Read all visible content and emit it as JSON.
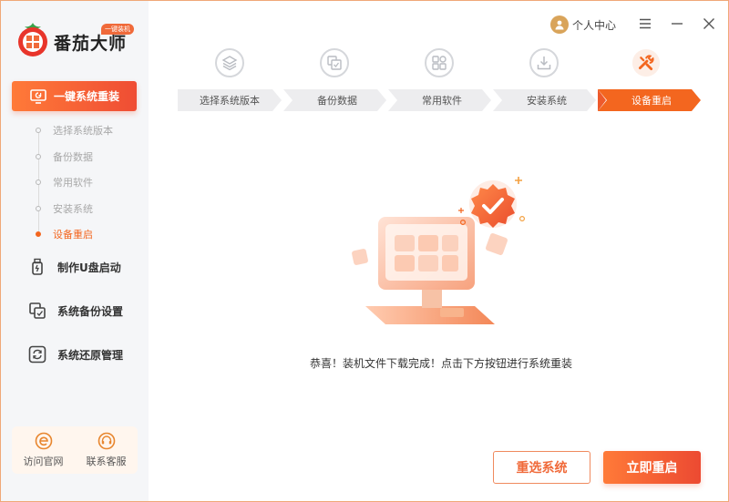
{
  "app": {
    "name": "番茄大师",
    "tag": "一键装机"
  },
  "sidebar": {
    "main_item": "一键系统重装",
    "substeps": [
      {
        "label": "选择系统版本",
        "active": false
      },
      {
        "label": "备份数据",
        "active": false
      },
      {
        "label": "常用软件",
        "active": false
      },
      {
        "label": "安装系统",
        "active": false
      },
      {
        "label": "设备重启",
        "active": true
      }
    ],
    "items": [
      {
        "label": "制作U盘启动",
        "icon": "usb-icon"
      },
      {
        "label": "系统备份设置",
        "icon": "backup-icon"
      },
      {
        "label": "系统还原管理",
        "icon": "restore-icon"
      }
    ],
    "bottom": {
      "website": "访问官网",
      "support": "联系客服"
    }
  },
  "topbar": {
    "user_center": "个人中心"
  },
  "steps": [
    {
      "label": "选择系统版本",
      "icon": "layers-icon",
      "active": false
    },
    {
      "label": "备份数据",
      "icon": "backup-icon",
      "active": false
    },
    {
      "label": "常用软件",
      "icon": "apps-icon",
      "active": false
    },
    {
      "label": "安装系统",
      "icon": "download-icon",
      "active": false
    },
    {
      "label": "设备重启",
      "icon": "tools-icon",
      "active": true
    }
  ],
  "main": {
    "message": "恭喜！装机文件下载完成！点击下方按钮进行系统重装",
    "reselect_button": "重选系统",
    "restart_button": "立即重启"
  },
  "colors": {
    "accent": "#f3661f",
    "accent_dark": "#ec4a32",
    "step_inactive": "#ededef"
  }
}
